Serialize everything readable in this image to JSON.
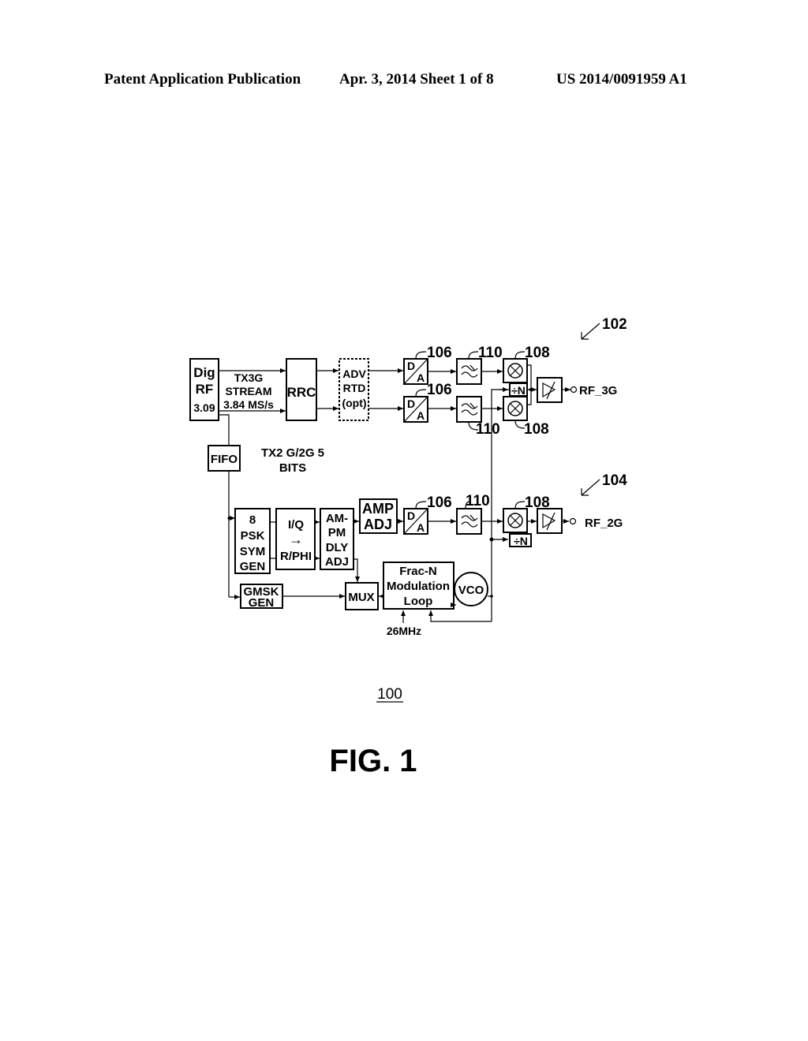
{
  "header": {
    "left": "Patent Application Publication",
    "middle": "Apr. 3, 2014   Sheet 1 of 8",
    "right": "US 2014/0091959 A1"
  },
  "figure": {
    "caption": "FIG. 1",
    "reference_numeral": "100",
    "refs": {
      "path_3g": "102",
      "path_2g": "104",
      "da": "106",
      "mixer": "108",
      "filter": "110"
    },
    "blocks": {
      "digrf": [
        "Dig",
        "RF",
        "3.09"
      ],
      "tx3g": [
        "TX3G",
        "STREAM",
        "3.84 MS/s"
      ],
      "rrc": "RRC",
      "advrtd": [
        "ADV",
        "RTD",
        "(opt)"
      ],
      "fifo": "FIFO",
      "tx2g": [
        "TX2 G/2G 5",
        "BITS"
      ],
      "psk": [
        "8",
        "PSK",
        "SYM",
        "GEN"
      ],
      "iq": [
        "I/Q",
        "→",
        "R/PHI"
      ],
      "ampm": [
        "AM-",
        "PM",
        "DLY",
        "ADJ"
      ],
      "ampadj": [
        "AMP",
        "ADJ"
      ],
      "gmsk": [
        "GMSK",
        "GEN"
      ],
      "mux": "MUX",
      "fracn": [
        "Frac-N",
        "Modulation",
        "Loop"
      ],
      "vco": "VCO",
      "clock": "26MHz",
      "divider": "÷N",
      "da_d": "D",
      "da_a": "A",
      "out_3g": "RF_3G",
      "out_2g": "RF_2G"
    }
  }
}
